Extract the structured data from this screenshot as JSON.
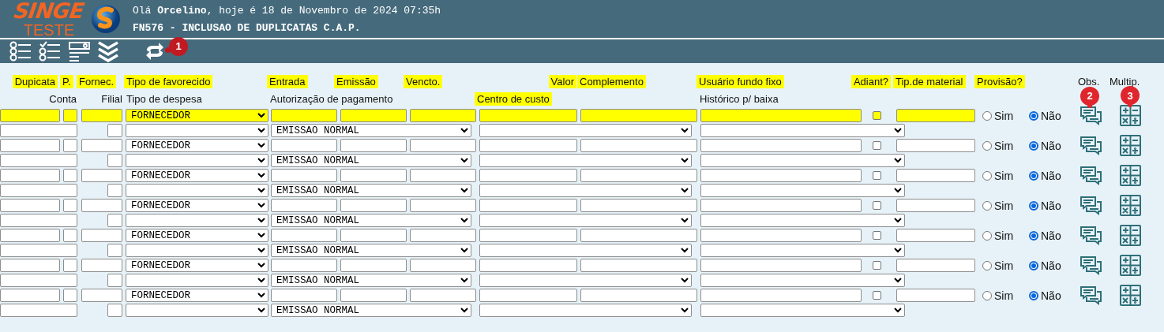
{
  "header": {
    "logo": {
      "title": "SINGE",
      "subtitle": "TESTE"
    },
    "greeting": "Olá **Orcelino**, hoje é 18 de Novembro de 2024 07:35h",
    "screen_title": "FN576 - INCLUSAO DE DUPLICATAS C.A.P."
  },
  "toolbar": {
    "buttons": [
      {
        "kind": "list"
      },
      {
        "kind": "checklist"
      },
      {
        "kind": "search-form"
      },
      {
        "kind": "chevrons"
      },
      {
        "kind": "refresh",
        "badge": "1"
      }
    ]
  },
  "columns": {
    "row_1": [
      {
        "label": "Dupicata",
        "highlighted": true
      },
      {
        "label": "P.",
        "highlighted": true
      },
      {
        "label": "Fornec.",
        "highlighted": true
      },
      {
        "label": "Tipo de favorecido",
        "highlighted": true
      },
      {
        "label": "Entrada",
        "highlighted": true
      },
      {
        "label": "Emissão",
        "highlighted": true
      },
      {
        "label": "Vencto.",
        "highlighted": true
      },
      {
        "label": "Valor",
        "highlighted": true
      },
      {
        "label": "Complemento",
        "highlighted": true
      },
      {
        "label": "Usuário fundo fixo",
        "highlighted": true
      },
      {
        "label": "Adiant?",
        "highlighted": true
      },
      {
        "label": "Tip.de material",
        "highlighted": true
      },
      {
        "label": "Provisão?",
        "highlighted": true
      },
      {
        "label": "Obs.",
        "highlighted": false
      },
      {
        "label": "Multip.",
        "highlighted": false
      }
    ],
    "row_2": [
      {
        "label": "Conta",
        "highlighted": false
      },
      {
        "label": "Filial",
        "highlighted": false
      },
      {
        "label": "Tipo de despesa",
        "highlighted": false
      },
      {
        "label": "Autorização de pagamento",
        "highlighted": false
      },
      {
        "label": "Centro de custo",
        "highlighted": true
      },
      {
        "label": "Histórico p/ baixa",
        "highlighted": false
      }
    ]
  },
  "annotations": {
    "obs": "2",
    "multip": "3"
  },
  "records": [
    {
      "highlighted": true,
      "favorecido": "FORNECEDOR",
      "autorizacao": "EMISSAO NORMAL",
      "adiantamento": false,
      "provisao": [
        {
          "label": "Sim",
          "selected": false
        },
        {
          "label": "Não",
          "selected": true
        }
      ]
    },
    {
      "highlighted": false,
      "favorecido": "FORNECEDOR",
      "autorizacao": "EMISSAO NORMAL",
      "adiantamento": false,
      "provisao": [
        {
          "label": "Sim",
          "selected": false
        },
        {
          "label": "Não",
          "selected": true
        }
      ]
    },
    {
      "highlighted": false,
      "favorecido": "FORNECEDOR",
      "autorizacao": "EMISSAO NORMAL",
      "adiantamento": false,
      "provisao": [
        {
          "label": "Sim",
          "selected": false
        },
        {
          "label": "Não",
          "selected": true
        }
      ]
    },
    {
      "highlighted": false,
      "favorecido": "FORNECEDOR",
      "autorizacao": "EMISSAO NORMAL",
      "adiantamento": false,
      "provisao": [
        {
          "label": "Sim",
          "selected": false
        },
        {
          "label": "Não",
          "selected": true
        }
      ]
    },
    {
      "highlighted": false,
      "favorecido": "FORNECEDOR",
      "autorizacao": "EMISSAO NORMAL",
      "adiantamento": false,
      "provisao": [
        {
          "label": "Sim",
          "selected": false
        },
        {
          "label": "Não",
          "selected": true
        }
      ]
    },
    {
      "highlighted": false,
      "favorecido": "FORNECEDOR",
      "autorizacao": "EMISSAO NORMAL",
      "adiantamento": false,
      "provisao": [
        {
          "label": "Sim",
          "selected": false
        },
        {
          "label": "Não",
          "selected": true
        }
      ]
    },
    {
      "highlighted": false,
      "favorecido": "FORNECEDOR",
      "autorizacao": "EMISSAO NORMAL",
      "adiantamento": false,
      "provisao": [
        {
          "label": "Sim",
          "selected": false
        },
        {
          "label": "Não",
          "selected": true
        }
      ]
    }
  ]
}
